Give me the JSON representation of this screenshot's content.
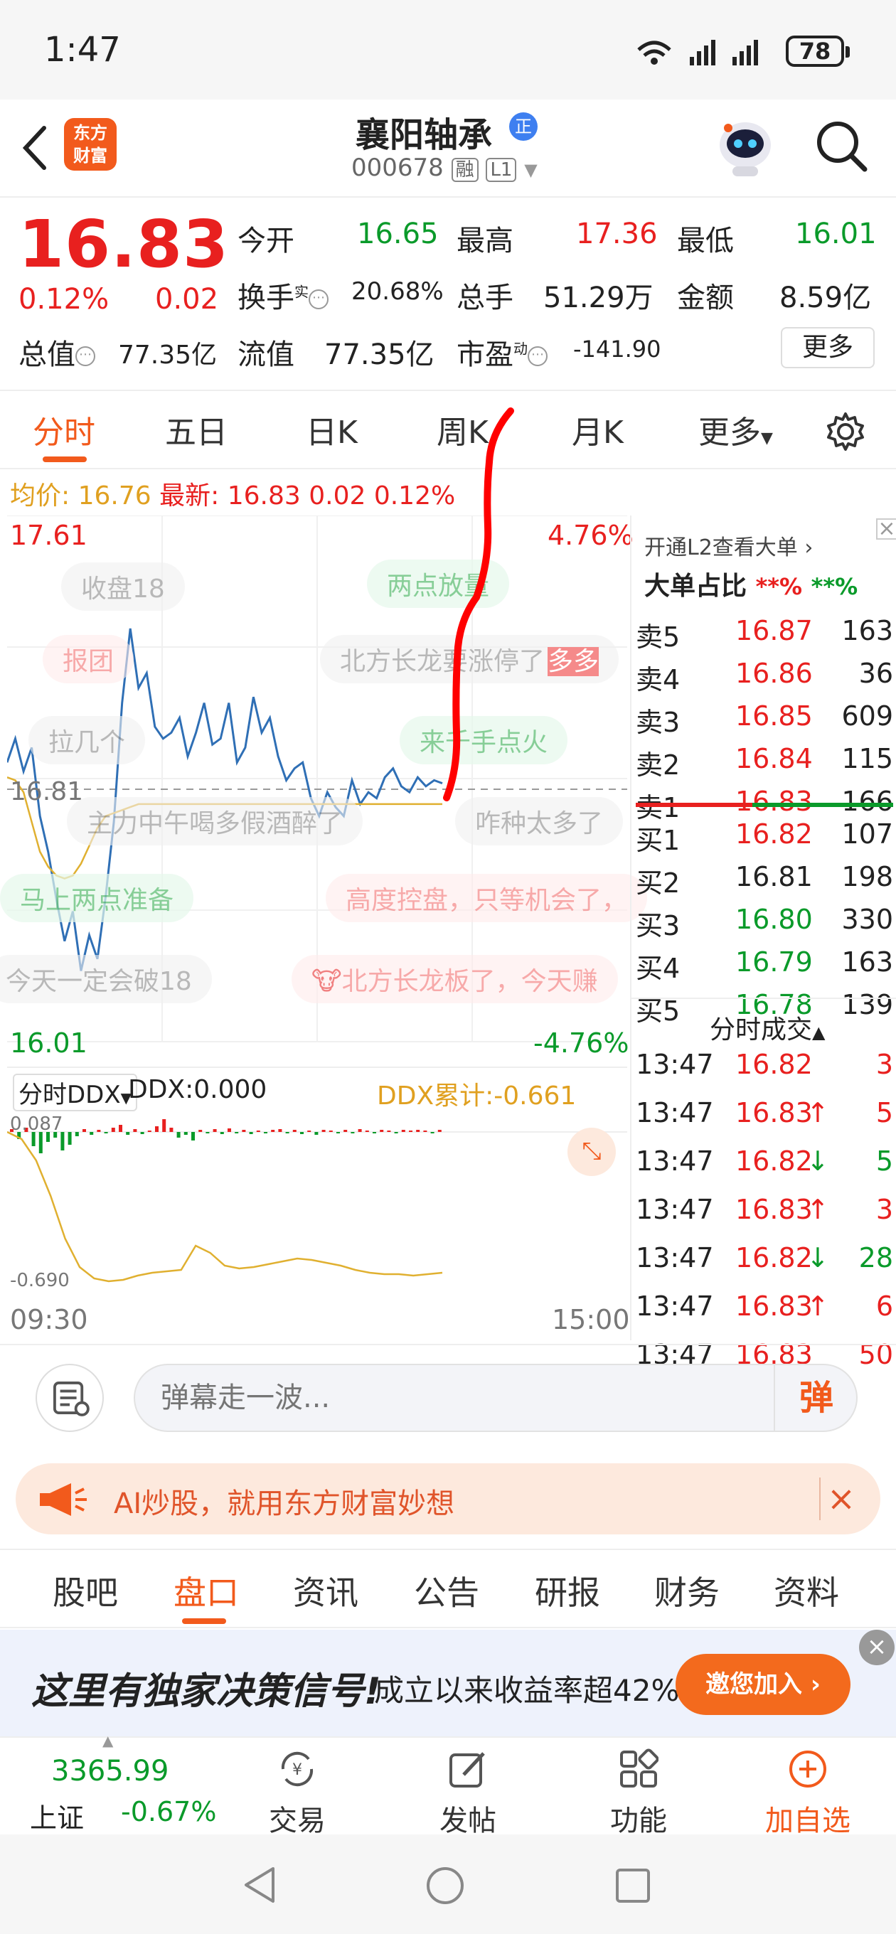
{
  "status_bar": {
    "time": "1:47",
    "battery": "78"
  },
  "header": {
    "logo_line1": "东方",
    "logo_line2": "财富",
    "stock_name": "襄阳轴承",
    "badge": "正",
    "stock_code": "000678",
    "tag_margin": "融",
    "tag_level": "L1"
  },
  "quote": {
    "price": "16.83",
    "change_pct": "0.12%",
    "change_val": "0.02",
    "open_label": "今开",
    "open": "16.65",
    "high_label": "最高",
    "high": "17.36",
    "low_label": "最低",
    "low": "16.01",
    "turnover_label": "换手",
    "turnover_sup": "实",
    "turnover": "20.68%",
    "volume_label": "总手",
    "volume": "51.29万",
    "amount_label": "金额",
    "amount": "8.59亿",
    "mktcap_label": "总值",
    "mktcap": "77.35亿",
    "float_label": "流值",
    "float": "77.35亿",
    "pe_label": "市盈",
    "pe_sup": "动",
    "pe": "-141.90",
    "more_label": "更多"
  },
  "chart_tabs": [
    "分时",
    "五日",
    "日K",
    "周K",
    "月K",
    "更多"
  ],
  "info_line": {
    "avg_label": "均价:",
    "avg": "16.76",
    "latest_label": "最新:",
    "latest": "16.83",
    "chg": "0.02",
    "pct": "0.12%"
  },
  "chart_data": {
    "type": "line",
    "title": "",
    "y_top": "17.61",
    "y_bottom": "16.01",
    "pct_top": "4.76%",
    "pct_bottom": "-4.76%",
    "prev_close": "16.81",
    "x_start": "09:30",
    "x_end": "15:00",
    "ylim": [
      16.01,
      17.61
    ],
    "series": [
      {
        "values": [
          16.9,
          16.98,
          16.87,
          16.95,
          16.72,
          16.6,
          16.44,
          16.3,
          16.4,
          16.2,
          16.32,
          16.24,
          16.45,
          16.7,
          17.1,
          17.35,
          17.15,
          17.2,
          17.02,
          16.98,
          17.0,
          17.05,
          16.92,
          17.0,
          17.1,
          16.96,
          16.98,
          17.1,
          16.9,
          16.95,
          17.12,
          17.0,
          17.05,
          16.92,
          16.84,
          16.88,
          16.9,
          16.78,
          16.72,
          16.8,
          16.75,
          16.72,
          16.84,
          16.76,
          16.8,
          16.78,
          16.85,
          16.88,
          16.82,
          16.8,
          16.85,
          16.82,
          16.84,
          16.83
        ]
      },
      {
        "values": [
          16.85,
          16.84,
          16.8,
          16.7,
          16.6,
          16.55,
          16.52,
          16.51,
          16.52,
          16.56,
          16.62,
          16.68,
          16.72,
          16.73,
          16.74,
          16.75,
          16.76,
          16.76,
          16.76,
          16.76,
          16.76,
          16.76,
          16.76,
          16.76,
          16.76,
          16.76,
          16.76,
          16.76,
          16.76,
          16.76,
          16.76,
          16.76,
          16.76,
          16.76,
          16.76,
          16.76,
          16.76,
          16.76,
          16.76,
          16.76,
          16.76,
          16.76,
          16.76,
          16.76,
          16.76,
          16.76,
          16.76,
          16.76,
          16.76,
          16.76,
          16.76,
          16.76,
          16.76,
          16.76
        ]
      }
    ]
  },
  "danmu": [
    "收盘18",
    "两点放量",
    "报团",
    "北方长龙要涨停了",
    "拉几个",
    "来千手点火",
    "主力中午喝多假酒醉了",
    "咋种太多了",
    "马上两点准备",
    "高度控盘，只等机会了，",
    "今天一定会破18",
    "北方长龙板了，今天赚"
  ],
  "danmu_emoji": "多多",
  "ddx": {
    "selector": "分时DDX",
    "ddx_label": "DDX:0.000",
    "cum_label": "DDX累计:-0.661",
    "top": "0.087",
    "bottom": "-0.690"
  },
  "orderbook": {
    "banner": "开通L2查看大单",
    "ratio_label": "大单占比",
    "ratio_red": "**%",
    "ratio_green": "**%",
    "asks": [
      {
        "label": "卖5",
        "price": "16.87",
        "vol": "163",
        "color": "#e8201f"
      },
      {
        "label": "卖4",
        "price": "16.86",
        "vol": "36",
        "color": "#e8201f"
      },
      {
        "label": "卖3",
        "price": "16.85",
        "vol": "609",
        "color": "#e8201f"
      },
      {
        "label": "卖2",
        "price": "16.84",
        "vol": "115",
        "color": "#e8201f"
      },
      {
        "label": "卖1",
        "price": "16.83",
        "vol": "166",
        "color": "#e8201f"
      }
    ],
    "bids": [
      {
        "label": "买1",
        "price": "16.82",
        "vol": "107",
        "color": "#e8201f"
      },
      {
        "label": "买2",
        "price": "16.81",
        "vol": "198",
        "color": "#222222"
      },
      {
        "label": "买3",
        "price": "16.80",
        "vol": "330",
        "color": "#0a9a2a"
      },
      {
        "label": "买4",
        "price": "16.79",
        "vol": "163",
        "color": "#0a9a2a"
      },
      {
        "label": "买5",
        "price": "16.78",
        "vol": "139",
        "color": "#0a9a2a"
      }
    ],
    "ticks_title": "分时成交",
    "ticks": [
      {
        "time": "13:47",
        "price": "16.82",
        "arrow": "",
        "vol": "3",
        "vol_color": "#e8201f"
      },
      {
        "time": "13:47",
        "price": "16.83",
        "arrow": "↑",
        "vol": "5",
        "vol_color": "#e8201f"
      },
      {
        "time": "13:47",
        "price": "16.82",
        "arrow": "↓",
        "vol": "5",
        "vol_color": "#0a9a2a"
      },
      {
        "time": "13:47",
        "price": "16.83",
        "arrow": "↑",
        "vol": "3",
        "vol_color": "#e8201f"
      },
      {
        "time": "13:47",
        "price": "16.82",
        "arrow": "↓",
        "vol": "28",
        "vol_color": "#0a9a2a"
      },
      {
        "time": "13:47",
        "price": "16.83",
        "arrow": "↑",
        "vol": "6",
        "vol_color": "#e8201f"
      },
      {
        "time": "13:47",
        "price": "16.83",
        "arrow": "",
        "vol": "50",
        "vol_color": "#e8201f"
      }
    ]
  },
  "danmu_input": {
    "placeholder": "弹幕走一波...",
    "send": "弹"
  },
  "ai_banner": {
    "text": "AI炒股，就用东方财富妙想"
  },
  "sub_tabs": [
    "股吧",
    "盘口",
    "资讯",
    "公告",
    "研报",
    "财务",
    "资料"
  ],
  "ad": {
    "title": "这里有独家决策信号!",
    "subtitle": "成立以来收益率超42%",
    "button": "邀您加入 ›"
  },
  "bottom_nav": {
    "index_value": "3365.99",
    "index_name": "上证",
    "index_change": "-0.67%",
    "items": [
      "交易",
      "发帖",
      "功能",
      "加自选"
    ]
  }
}
